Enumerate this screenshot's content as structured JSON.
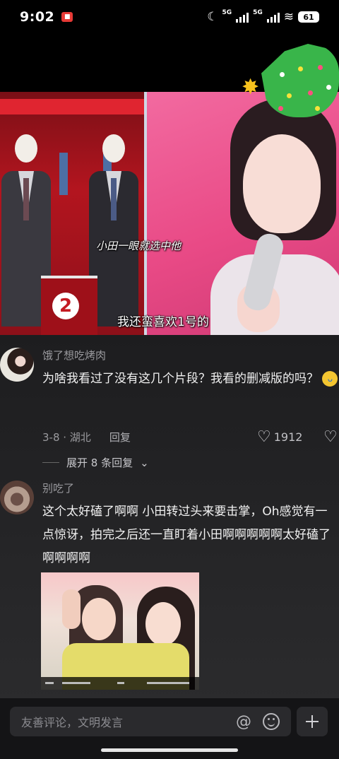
{
  "status_bar": {
    "time": "9:02",
    "network_1": "5G",
    "network_2": "5G",
    "battery": "61"
  },
  "video": {
    "subtitle_small": "小田一眼就选中他",
    "subtitle_main": "我还蛮喜欢1号的",
    "badge_number": "2"
  },
  "comments": [
    {
      "username": "饿了想吃烤肉",
      "text": "为啥我看过了没有这几个片段？我看的删减版的吗？",
      "date_location": "3-8 · 湖北",
      "reply_label": "回复",
      "likes": "1912",
      "expand_label": "展开 8 条回复"
    },
    {
      "username": "别吃了",
      "text": "这个太好磕了啊啊 小田转过头来要击掌，Oh感觉有一点惊讶，拍完之后还一直盯着小田啊啊啊啊啊太好磕了啊啊啊啊"
    }
  ],
  "input_bar": {
    "placeholder": "友善评论，文明发言",
    "at_symbol": "@"
  },
  "colors": {
    "background": "#000000",
    "comment_bg": "#1d1d1f",
    "accent_red": "#e02530"
  }
}
